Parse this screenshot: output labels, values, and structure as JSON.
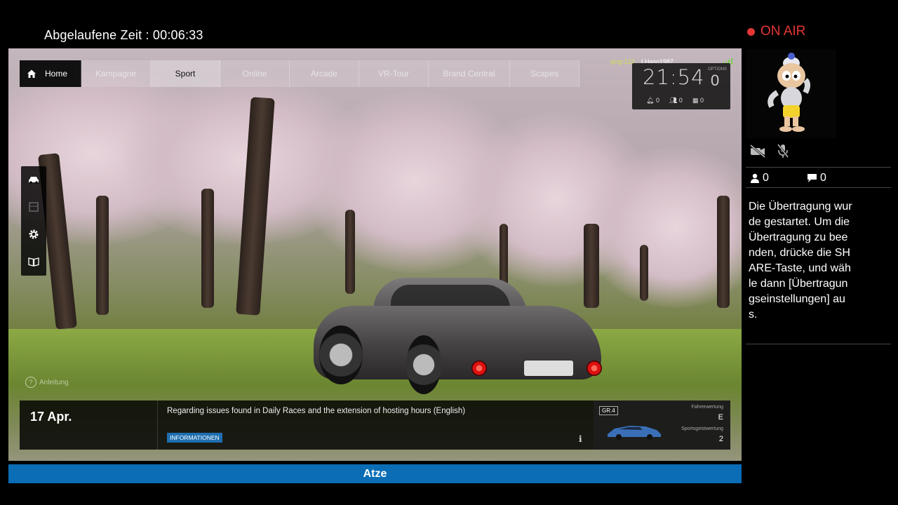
{
  "broadcast": {
    "elapsed_time": "Abgelaufene Zeit : 00:06:33",
    "on_air": "ON AIR",
    "viewers": "0",
    "comments": "0",
    "message": "Die Übertragung wurde gestartet. Um die Übertragung zu beenden, drücke die SHARE-Taste, und wähle dann [Übertragungseinstellungen] aus.",
    "bottom_label": "Atze",
    "accent_color": "#e53535",
    "bar_color": "#0a6db5"
  },
  "game": {
    "menu": {
      "home": "Home",
      "tabs": [
        "Kampagne",
        "Sport",
        "Online",
        "Arcade",
        "VR-Tour",
        "Brand Central",
        "Scapes"
      ],
      "active_tab": "Sport"
    },
    "hud": {
      "ping": "ping:123",
      "username": "LHaso1987",
      "clock": "21:54",
      "clock_extra": "0",
      "options_label": "OPTIONS",
      "notifications": "0",
      "friends": "0",
      "calendar": "0"
    },
    "guide_label": "Anleitung",
    "news": {
      "date": "17 Apr.",
      "headline": "Regarding issues found in Daily Races and the extension of hosting hours (English)",
      "badge": "INFORMATIONEN",
      "info_icon": "i"
    },
    "profile": {
      "tag": "GR.4",
      "driver_rating_label": "Fahrerwertung",
      "driver_rating": "E",
      "sportsmanship_label": "Sportsgeistwertung",
      "sportsmanship": "2"
    },
    "sidebar_icons": [
      "car-icon",
      "garage-icon",
      "settings-gear-icon",
      "manual-book-icon"
    ]
  }
}
